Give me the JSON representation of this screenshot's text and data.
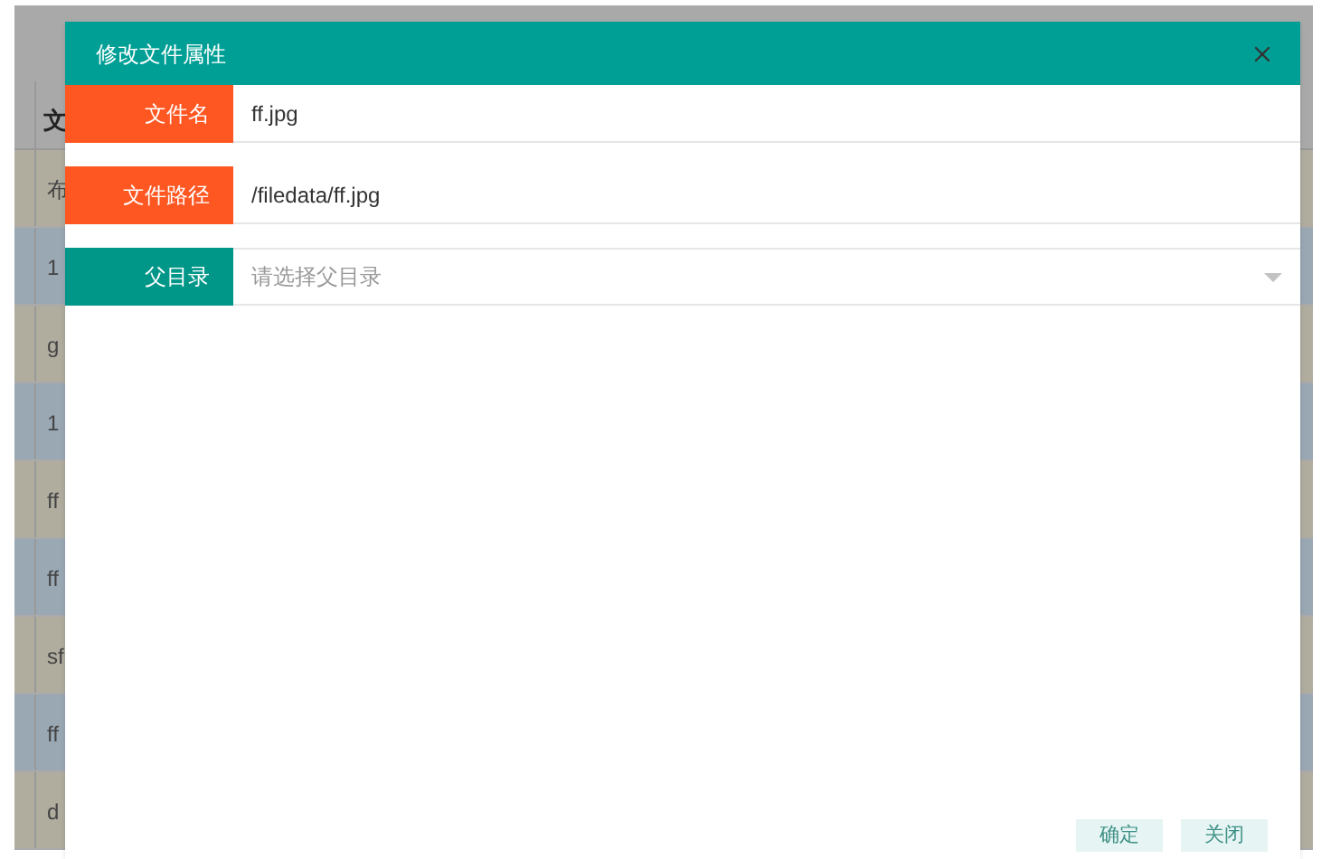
{
  "background_table": {
    "header": "文",
    "rows": [
      {
        "cell": "布"
      },
      {
        "cell": "1"
      },
      {
        "cell": "g"
      },
      {
        "cell": "1"
      },
      {
        "cell": "ff"
      },
      {
        "cell": "ff"
      },
      {
        "cell": "sf"
      },
      {
        "cell": "ff"
      },
      {
        "cell": "d"
      }
    ]
  },
  "dialog": {
    "title": "修改文件属性",
    "fields": [
      {
        "kind": "input",
        "label": "文件名",
        "color": "#ff5722",
        "value": "ff.jpg"
      },
      {
        "kind": "input",
        "label": "文件路径",
        "color": "#ff5722",
        "value": "/filedata/ff.jpg"
      },
      {
        "kind": "select",
        "label": "父目录",
        "color": "#009688",
        "placeholder": "请选择父目录"
      }
    ],
    "buttons": [
      "确定",
      "关闭"
    ]
  }
}
